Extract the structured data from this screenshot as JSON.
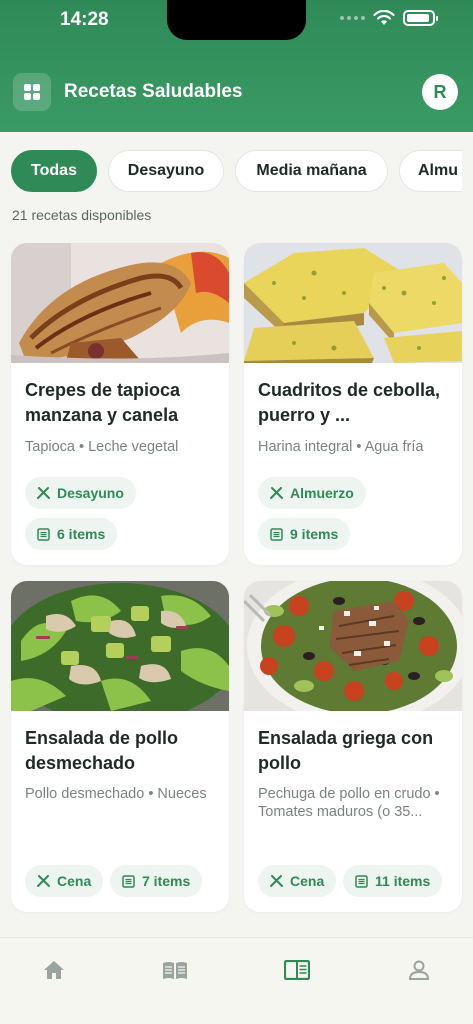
{
  "status_bar": {
    "time": "14:28"
  },
  "header": {
    "title": "Recetas Saludables",
    "avatar_initial": "R"
  },
  "filters": [
    {
      "label": "Todas",
      "active": true
    },
    {
      "label": "Desayuno",
      "active": false
    },
    {
      "label": "Media mañana",
      "active": false
    },
    {
      "label": "Almu",
      "active": false
    }
  ],
  "summary": {
    "count_text": "21 recetas disponibles"
  },
  "recipes": [
    {
      "title": "Crepes de tapioca manzana y canela",
      "ingredients": "Tapioca • Leche vegetal",
      "meal": "Desayuno",
      "items": "6 items"
    },
    {
      "title": "Cuadritos de cebolla, puerro y ...",
      "ingredients": "Harina integral • Agua fría",
      "meal": "Almuerzo",
      "items": "9 items"
    },
    {
      "title": "Ensalada de pollo desmechado",
      "ingredients": "Pollo desmechado • Nueces",
      "meal": "Cena",
      "items": "7 items"
    },
    {
      "title": "Ensalada griega con pollo",
      "ingredients": "Pechuga de pollo en crudo • Tomates maduros (o 35...",
      "meal": "Cena",
      "items": "11 items"
    }
  ],
  "bottom_nav": [
    {
      "icon": "home-icon",
      "active": false
    },
    {
      "icon": "book-icon",
      "active": false
    },
    {
      "icon": "recipes-icon",
      "active": true
    },
    {
      "icon": "profile-icon",
      "active": false
    }
  ],
  "colors": {
    "primary": "#2f8a57",
    "tag_bg": "#eef4ef",
    "nav_inactive": "#9aa39f"
  }
}
